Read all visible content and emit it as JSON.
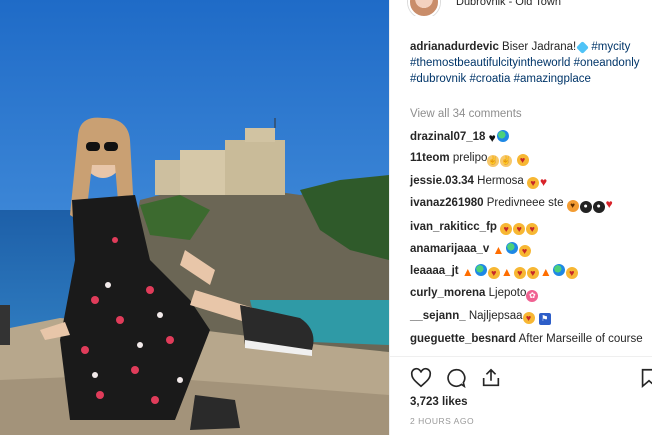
{
  "header": {
    "location": "Dubrovnik - Old Town"
  },
  "caption": {
    "username": "adrianadurdevic",
    "text": "Biser Jadrana!",
    "tags": [
      "#mycity",
      "#themostbeautifulcityintheworld",
      "#oneandonly",
      "#dubrovnik",
      "#croatia",
      "#amazingplace"
    ]
  },
  "view_all": "View all 34 comments",
  "comments": [
    {
      "user": "drazinal07_18",
      "text": ""
    },
    {
      "user": "11teom",
      "text": "prelipo"
    },
    {
      "user": "jessie.03.34",
      "text": "Hermosa"
    },
    {
      "user": "ivanaz261980",
      "text": "Predivneee ste"
    },
    {
      "user": "ivan_rakiticc_fp",
      "text": ""
    },
    {
      "user": "anamarijaaa_v",
      "text": ""
    },
    {
      "user": "leaaaa_jt",
      "text": ""
    },
    {
      "user": "curly_morena",
      "text": "Ljepoto"
    },
    {
      "user": "__sejann_",
      "text": "Najljepsaa"
    },
    {
      "user": "gueguette_besnard",
      "text": "After Marseille of course"
    }
  ],
  "likes": "3,723 likes",
  "timestamp": "2 HOURS AGO",
  "icons": {
    "like": "heart-icon",
    "comment": "comment-icon",
    "share": "share-icon",
    "save": "bookmark-icon"
  }
}
